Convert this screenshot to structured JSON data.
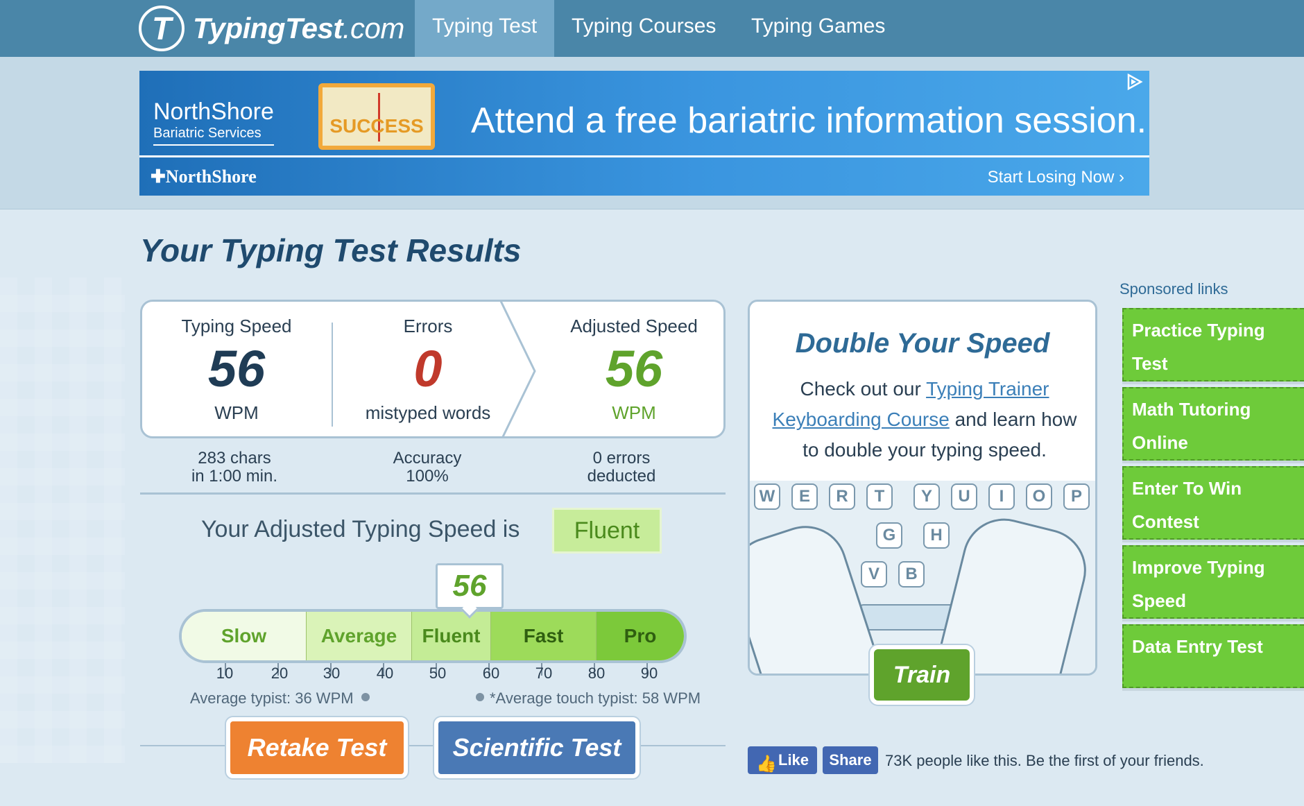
{
  "nav": {
    "logo_name": "TypingTest",
    "logo_suffix": ".com",
    "logo_letter": "T",
    "tabs": [
      {
        "label": "Typing Test",
        "active": true
      },
      {
        "label": "Typing Courses",
        "active": false
      },
      {
        "label": "Typing Games",
        "active": false
      }
    ]
  },
  "ad": {
    "brand_name": "NorthShore",
    "brand_sub": "Bariatric Services",
    "gauge_text": "SUCCESS",
    "headline": "Attend a free bariatric information session.",
    "bottom_logo": "NorthShore",
    "cta": "Start Losing Now ›",
    "choice_icon": "ad-choices-icon"
  },
  "results": {
    "title": "Your Typing Test Results",
    "typing_speed": {
      "label": "Typing Speed",
      "value": "56",
      "unit": "WPM"
    },
    "errors": {
      "label": "Errors",
      "value": "0",
      "unit": "mistyped words"
    },
    "adjusted": {
      "label": "Adjusted Speed",
      "value": "56",
      "unit": "WPM"
    },
    "chars": {
      "line1": "283 chars",
      "line2": "in 1:00 min."
    },
    "accuracy": {
      "line1": "Accuracy",
      "line2": "100%"
    },
    "deducted": {
      "line1": "0 errors",
      "line2": "deducted"
    },
    "speed_sentence": "Your Adjusted Typing Speed is",
    "speed_level": "Fluent"
  },
  "scale": {
    "marker_value": "56",
    "segments": [
      "Slow",
      "Average",
      "Fluent",
      "Fast",
      "Pro"
    ],
    "ticks": [
      "10",
      "20",
      "30",
      "40",
      "50",
      "60",
      "70",
      "80",
      "90"
    ],
    "avg_typist": "Average typist: 36 WPM",
    "avg_touch": "*Average touch typist: 58 WPM"
  },
  "buttons": {
    "retake": "Retake Test",
    "scientific": "Scientific Test",
    "train": "Train"
  },
  "double_speed": {
    "title": "Double Your Speed",
    "text_pre": "Check out our ",
    "link1": "Typing Trainer",
    "link2": "Keyboarding Course",
    "text_post": " and learn how to double your typing speed.",
    "keys_top": [
      "W",
      "E",
      "R",
      "T",
      "Y",
      "U",
      "I",
      "O",
      "P"
    ],
    "keys_mid": [
      "G",
      "H"
    ],
    "keys_bottom": [
      "V",
      "B"
    ]
  },
  "social": {
    "like": "Like",
    "share": "Share",
    "text": "73K people like this. Be the first of your friends."
  },
  "sponsored": {
    "label": "Sponsored links",
    "links": [
      {
        "line1": "Practice Typing",
        "line2": "Test"
      },
      {
        "line1": "Math Tutoring",
        "line2": "Online"
      },
      {
        "line1": "Enter To Win",
        "line2": "Contest"
      },
      {
        "line1": "Improve Typing",
        "line2": "Speed"
      },
      {
        "line1": "Data Entry Test",
        "line2": ""
      }
    ]
  },
  "colors": {
    "nav": "#4a86a8",
    "slow": "#f1fae6",
    "average": "#daf3b8",
    "fluent": "#c4ec96",
    "fast": "#9ddb5a",
    "pro": "#7cc93a",
    "errors_red": "#c0392b",
    "speed_dark": "#1f3c55",
    "adjusted_green": "#5fa32c"
  }
}
